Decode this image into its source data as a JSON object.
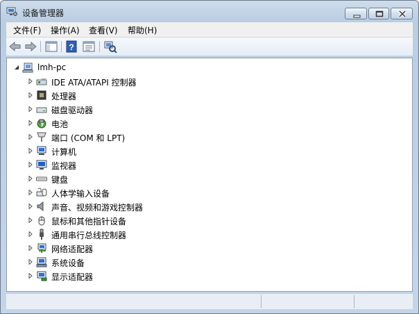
{
  "window": {
    "title": "设备管理器"
  },
  "menu": [
    {
      "label": "文件(F)"
    },
    {
      "label": "操作(A)"
    },
    {
      "label": "查看(V)"
    },
    {
      "label": "帮助(H)"
    }
  ],
  "toolbar": {
    "buttons": [
      "back-icon",
      "forward-icon",
      "show-hide-console-tree-icon",
      "help-icon",
      "properties-icon",
      "scan-hardware-icon"
    ]
  },
  "tree": {
    "root": {
      "label": "lmh-pc",
      "icon": "computer-icon"
    },
    "items": [
      {
        "label": "IDE ATA/ATAPI 控制器",
        "icon": "ide-controller-icon"
      },
      {
        "label": "处理器",
        "icon": "processor-icon"
      },
      {
        "label": "磁盘驱动器",
        "icon": "disk-drive-icon"
      },
      {
        "label": "电池",
        "icon": "battery-icon"
      },
      {
        "label": "端口 (COM 和 LPT)",
        "icon": "port-icon"
      },
      {
        "label": "计算机",
        "icon": "computer-icon"
      },
      {
        "label": "监视器",
        "icon": "monitor-icon"
      },
      {
        "label": "键盘",
        "icon": "keyboard-icon"
      },
      {
        "label": "人体学输入设备",
        "icon": "hid-icon"
      },
      {
        "label": "声音、视频和游戏控制器",
        "icon": "sound-icon"
      },
      {
        "label": "鼠标和其他指针设备",
        "icon": "mouse-icon"
      },
      {
        "label": "通用串行总线控制器",
        "icon": "usb-icon"
      },
      {
        "label": "网络适配器",
        "icon": "network-adapter-icon"
      },
      {
        "label": "系统设备",
        "icon": "system-device-icon"
      },
      {
        "label": "显示适配器",
        "icon": "display-adapter-icon"
      }
    ]
  },
  "colors": {
    "chrome": "#c4d5e8",
    "border": "#6b7a8c",
    "menubar": "#f0f0f0"
  }
}
